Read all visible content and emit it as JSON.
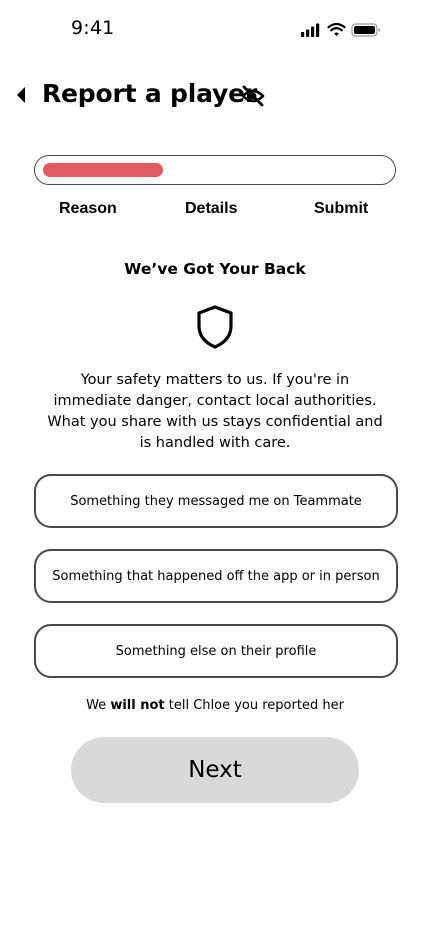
{
  "status_bar": {
    "time": "9:41"
  },
  "header": {
    "title": "Report a player"
  },
  "progress": {
    "fraction": 0.35,
    "steps": [
      "Reason",
      "Details",
      "Submit"
    ]
  },
  "intro": {
    "title": "We’ve Got Your Back",
    "body": "Your safety matters to us. If you're in immediate danger, contact local authorities. What you share with us stays confidential and is handled with care."
  },
  "options": [
    "Something they messaged me on Teammate",
    "Something that happened off the app or in person",
    "Something else on their profile"
  ],
  "privacy_note": {
    "before": "We ",
    "emphasis": "will not",
    "after": " tell Chloe you reported her"
  },
  "next_button": {
    "label": "Next"
  },
  "colors": {
    "progress_fill": "#e05a62",
    "next_button_bg": "#d9d9d9",
    "outline": "#4a4a4a"
  },
  "icons": [
    "cellular-signal-icon",
    "wifi-icon",
    "battery-icon",
    "back-arrow-icon",
    "eye-slash-icon",
    "shield-icon"
  ]
}
